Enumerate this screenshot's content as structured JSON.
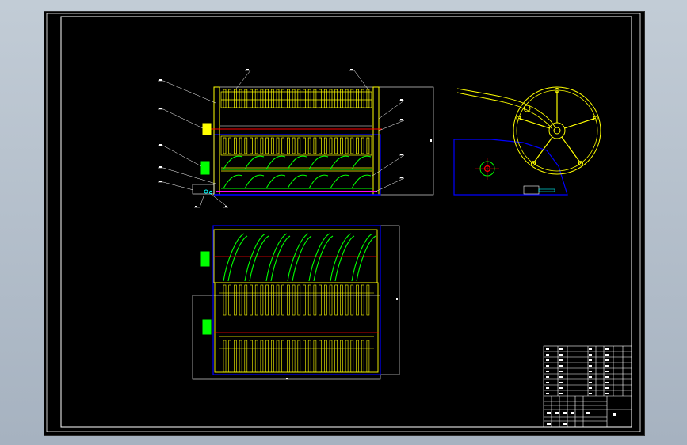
{
  "drawing": {
    "background": "#000000",
    "viewport_bg": "#a9b6c4",
    "colors": {
      "frame": "#ffffff",
      "rakes": "#ffff00",
      "auger": "#00ff00",
      "housing": "#0000ff",
      "shaft": "#ff0000",
      "trough": "#ff00ff",
      "bearing": "#00ffff"
    },
    "callouts": [
      "1",
      "2",
      "3",
      "4",
      "5",
      "6",
      "7",
      "8",
      "9",
      "10",
      "11",
      "12",
      "13",
      "14",
      "15"
    ]
  },
  "title_block": {
    "rows": 17,
    "columns": 7
  }
}
